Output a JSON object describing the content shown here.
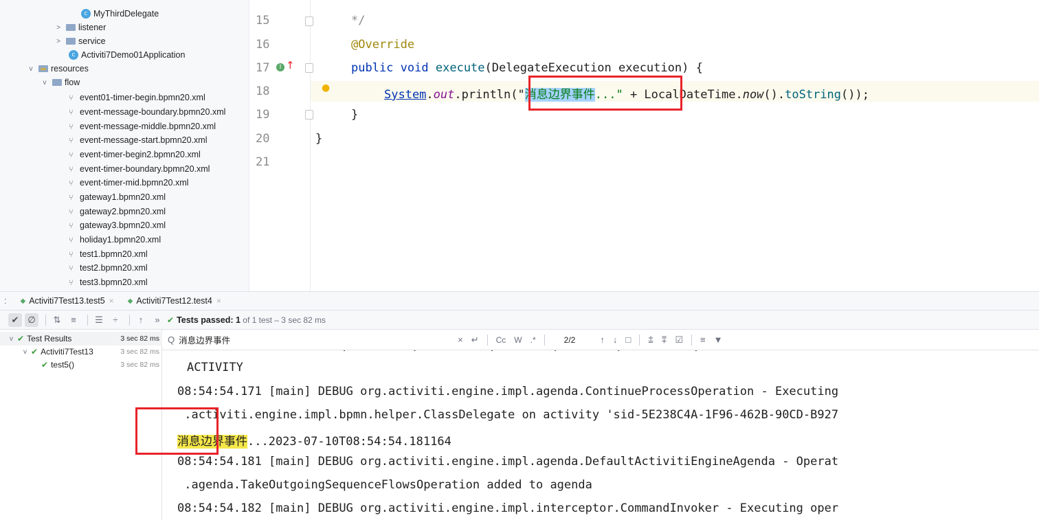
{
  "project_tree": {
    "items": [
      {
        "label": "MyThirdDelegate",
        "kind": "class"
      },
      {
        "label": "listener",
        "kind": "folder",
        "collapsed": true
      },
      {
        "label": "service",
        "kind": "folder",
        "collapsed": true
      },
      {
        "label": "Activiti7Demo01Application",
        "kind": "class"
      },
      {
        "label": "resources",
        "kind": "resources-folder",
        "collapsed": false
      },
      {
        "label": "flow",
        "kind": "folder",
        "collapsed": false
      },
      {
        "label": "event01-timer-begin.bpmn20.xml",
        "kind": "xml"
      },
      {
        "label": "event-message-boundary.bpmn20.xml",
        "kind": "xml"
      },
      {
        "label": "event-message-middle.bpmn20.xml",
        "kind": "xml"
      },
      {
        "label": "event-message-start.bpmn20.xml",
        "kind": "xml"
      },
      {
        "label": "event-timer-begin2.bpmn20.xml",
        "kind": "xml"
      },
      {
        "label": "event-timer-boundary.bpmn20.xml",
        "kind": "xml"
      },
      {
        "label": "event-timer-mid.bpmn20.xml",
        "kind": "xml"
      },
      {
        "label": "gateway1.bpmn20.xml",
        "kind": "xml"
      },
      {
        "label": "gateway2.bpmn20.xml",
        "kind": "xml"
      },
      {
        "label": "gateway3.bpmn20.xml",
        "kind": "xml"
      },
      {
        "label": "holiday1.bpmn20.xml",
        "kind": "xml"
      },
      {
        "label": "test1.bpmn20.xml",
        "kind": "xml"
      },
      {
        "label": "test2.bpmn20.xml",
        "kind": "xml"
      },
      {
        "label": "test3.bpmn20.xml",
        "kind": "xml"
      }
    ]
  },
  "editor": {
    "line_numbers": [
      "15",
      "16",
      "17",
      "18",
      "19",
      "20",
      "21"
    ],
    "line15": "*/",
    "line16": "@Override",
    "line17": {
      "kw1": "public",
      "kw2": "void",
      "method": "execute",
      "rest": "(DelegateExecution execution) {"
    },
    "line18": {
      "system": "System",
      "dot1": ".",
      "out": "out",
      "println": ".println(\"",
      "selected": "消息边界事件",
      "str_tail": "...\"",
      "plus": " + LocalDateTime.",
      "now": "now",
      "tail": "().",
      "tostring": "toString",
      "end": "());"
    },
    "line19": "}",
    "line20": "}"
  },
  "run_tabs": [
    {
      "label": "Activiti7Test13.test5"
    },
    {
      "label": "Activiti7Test12.test4"
    }
  ],
  "run_toolbar": {
    "status_bold": "Tests passed: 1",
    "status_rest": " of 1 test – 3 sec 82 ms"
  },
  "results": [
    {
      "label": "Test Results",
      "time": "3 sec 82 ms"
    },
    {
      "label": "Activiti7Test13",
      "time": "3 sec 82 ms"
    },
    {
      "label": "test5()",
      "time": "3 sec 82 ms"
    }
  ],
  "find": {
    "query": "消息边界事件",
    "case_label": "Cc",
    "word_label": "W",
    "regex_label": ".*",
    "match_count": "2/2"
  },
  "console": {
    "lines": [
      "ACTIVITY",
      "08:54:54.171 [main] DEBUG org.activiti.engine.impl.agenda.ContinueProcessOperation - Executing",
      " .activiti.engine.impl.bpmn.helper.ClassDelegate on activity 'sid-5E238C4A-1F96-462B-90CD-B927",
      "...2023-07-10T08:54:54.181164",
      "08:54:54.181 [main] DEBUG org.activiti.engine.impl.agenda.DefaultActivitiEngineAgenda - Operat",
      " .agenda.TakeOutgoingSequenceFlowsOperation added to agenda",
      "08:54:54.182 [main] DEBUG org.activiti.engine.impl.interceptor.CommandInvoker - Executing oper"
    ],
    "highlight": "消息边界事件"
  },
  "colors": {
    "annotation_box": "#e8232a",
    "match_highlight": "#f5e74a",
    "selection": "#a6d2ff",
    "pass_green": "#3e9b3e"
  }
}
